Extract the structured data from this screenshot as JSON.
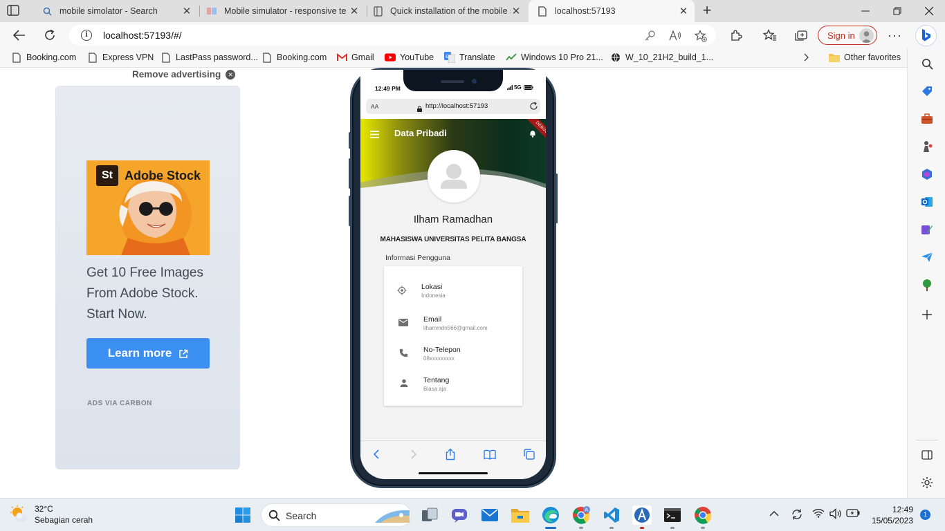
{
  "browser": {
    "tabs": [
      {
        "title": "mobile simolator - Search",
        "icon": "search-icon",
        "active": false
      },
      {
        "title": "Mobile simulator - responsive te",
        "icon": "mobile-simulator-favicon",
        "active": false
      },
      {
        "title": "Quick installation of the mobile s",
        "icon": "page-icon",
        "active": false
      },
      {
        "title": "localhost:57193",
        "icon": "page-icon",
        "active": true
      }
    ],
    "url": "localhost:57193/#/",
    "sign_in": "Sign in",
    "favorites": [
      {
        "label": "Booking.com",
        "icon": "page-icon"
      },
      {
        "label": "Express VPN",
        "icon": "page-icon"
      },
      {
        "label": "LastPass password...",
        "icon": "page-icon"
      },
      {
        "label": "Booking.com",
        "icon": "page-icon"
      },
      {
        "label": "Gmail",
        "icon": "gmail-icon"
      },
      {
        "label": "YouTube",
        "icon": "youtube-icon"
      },
      {
        "label": "Translate",
        "icon": "translate-icon"
      },
      {
        "label": "Windows 10 Pro 21...",
        "icon": "windows-link-icon"
      },
      {
        "label": "W_10_21H2_build_1...",
        "icon": "globe-icon"
      }
    ],
    "other_favorites": "Other favorites"
  },
  "ad": {
    "remove": "Remove advertising",
    "brand": "Adobe Stock",
    "brand_badge": "St",
    "text": "Get 10 Free Images From Adobe Stock. Start Now.",
    "button": "Learn more",
    "footer": "ADS VIA CARBON"
  },
  "phone": {
    "time": "12:49 PM",
    "network": "5G",
    "text_size": "AA",
    "url": "http://localhost:57193",
    "app_title": "Data Pribadi",
    "debug": "DEBUG",
    "name": "Ilham Ramadhan",
    "subtitle": "MAHASISWA UNIVERSITAS PELITA BANGSA",
    "section": "Informasi Pengguna",
    "info": [
      {
        "title": "Lokasi",
        "value": "Indonesia",
        "icon": "location-icon"
      },
      {
        "title": "Email",
        "value": "ilhammdn566@gmail.com",
        "icon": "email-icon"
      },
      {
        "title": "No-Telepon",
        "value": "08xxxxxxxxx",
        "icon": "phone-icon"
      },
      {
        "title": "Tentang",
        "value": "Biasa aja",
        "icon": "person-icon"
      }
    ]
  },
  "taskbar": {
    "temperature": "32°C",
    "weather": "Sebagian cerah",
    "search": "Search",
    "time": "12:49",
    "date": "15/05/2023",
    "notifications": "1"
  }
}
